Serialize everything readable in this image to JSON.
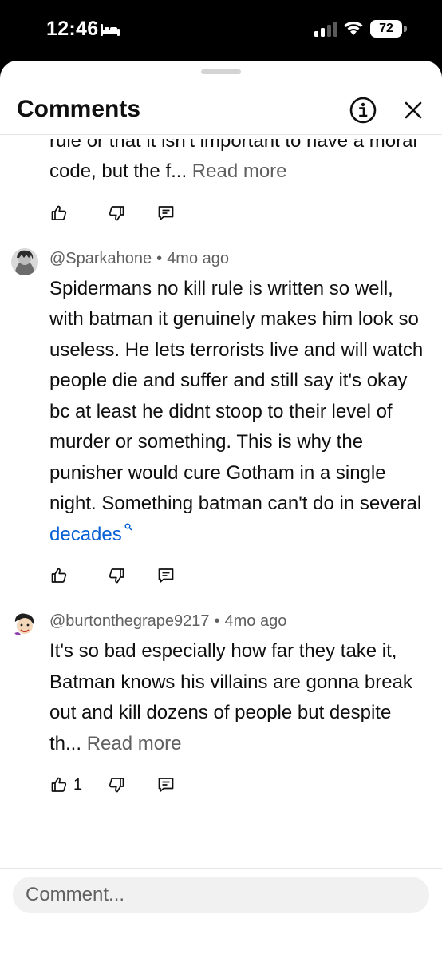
{
  "status_bar": {
    "time": "12:46",
    "battery": "72",
    "icons": [
      "bed-icon",
      "cellular-signal-icon",
      "wifi-icon",
      "battery-icon"
    ]
  },
  "sheet": {
    "title": "Comments",
    "info_icon": "info-icon",
    "close_icon": "close-icon"
  },
  "comments": [
    {
      "partial": true,
      "text": "rule or that it isn't important to have a moral code, but the f...",
      "read_more": "Read more",
      "likes": ""
    },
    {
      "author": "@Sparkahone",
      "separator": "•",
      "age": "4mo ago",
      "text": "Spidermans no kill rule is written so well, with batman it genuinely makes him look so useless. He lets terrorists live and will watch people die and suffer and still say it's okay bc at least he didnt stoop to their level of murder or something. This is why the punisher would cure Gotham in a single night. Something batman can't do in several ",
      "link_text": "decades",
      "likes": ""
    },
    {
      "author": "@burtonthegrape9217",
      "separator": "•",
      "age": "4mo ago",
      "text": "It's so bad especially how far they take it, Batman knows his villains are gonna break out and kill dozens of people but despite th...",
      "read_more": "Read more",
      "likes": "1"
    }
  ],
  "action_icons": [
    "like-icon",
    "dislike-icon",
    "reply-icon"
  ],
  "composer": {
    "placeholder": "Comment..."
  },
  "colors": {
    "link": "#065fd4",
    "secondary_text": "#606060",
    "primary_text": "#0f0f0f",
    "input_bg": "#f1f1f1"
  }
}
